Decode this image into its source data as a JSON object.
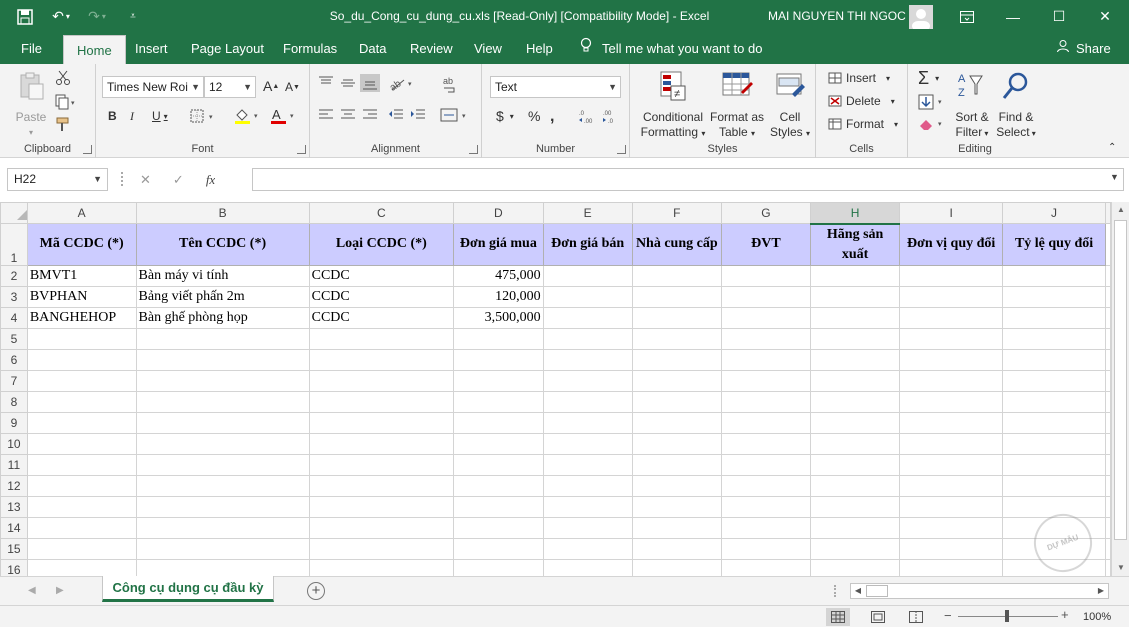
{
  "window": {
    "title": "So_du_Cong_cu_dung_cu.xls  [Read-Only]  [Compatibility Mode]  -  Excel",
    "user": "MAI NGUYEN THI NGOC"
  },
  "tabs": [
    "File",
    "Home",
    "Insert",
    "Page Layout",
    "Formulas",
    "Data",
    "Review",
    "View",
    "Help"
  ],
  "active_tab": "Home",
  "tell_me": "Tell me what you want to do",
  "share": "Share",
  "ribbon": {
    "clipboard": {
      "label": "Clipboard",
      "paste": "Paste"
    },
    "font": {
      "label": "Font",
      "font_name": "Times New Roi",
      "font_size": "12"
    },
    "alignment": {
      "label": "Alignment"
    },
    "number": {
      "label": "Number",
      "format": "Text"
    },
    "styles": {
      "label": "Styles",
      "conditional_1": "Conditional",
      "conditional_2": "Formatting",
      "format_table_1": "Format as",
      "format_table_2": "Table",
      "cell_styles_1": "Cell",
      "cell_styles_2": "Styles"
    },
    "cells": {
      "label": "Cells",
      "insert": "Insert",
      "delete": "Delete",
      "format": "Format"
    },
    "editing": {
      "label": "Editing",
      "sort_1": "Sort &",
      "sort_2": "Filter",
      "find_1": "Find &",
      "find_2": "Select"
    }
  },
  "formula_bar": {
    "name_box": "H22",
    "fx": "fx",
    "value": ""
  },
  "sheet": {
    "columns": [
      "A",
      "B",
      "C",
      "D",
      "E",
      "F",
      "G",
      "H",
      "I",
      "J"
    ],
    "selected_column": "H",
    "header_row": [
      "Mã CCDC (*)",
      "Tên CCDC (*)",
      "Loại CCDC (*)",
      "Đơn giá mua",
      "Đơn giá bán",
      "Nhà cung cấp",
      "ĐVT",
      "Hãng sản xuất",
      "Đơn vị quy đổi",
      "Tỷ lệ quy đổi"
    ],
    "rows": [
      [
        "BMVT1",
        "Bàn máy vi tính",
        "CCDC",
        "475,000",
        "",
        "",
        "",
        "",
        "",
        ""
      ],
      [
        "BVPHAN",
        "Bảng viết phấn 2m",
        "CCDC",
        "120,000",
        "",
        "",
        "",
        "",
        "",
        ""
      ],
      [
        "BANGHEHOP",
        "Bàn ghế phòng họp",
        "CCDC",
        "3,500,000",
        "",
        "",
        "",
        "",
        "",
        ""
      ]
    ],
    "row_numbers": [
      "1",
      "2",
      "3",
      "4",
      "5",
      "6",
      "7",
      "8",
      "9",
      "10",
      "11",
      "12",
      "13",
      "14",
      "15",
      "16"
    ]
  },
  "sheet_tab": "Công cụ dụng cụ đầu kỳ",
  "status": {
    "zoom": "100%"
  },
  "watermark": "DỰ MẪU"
}
